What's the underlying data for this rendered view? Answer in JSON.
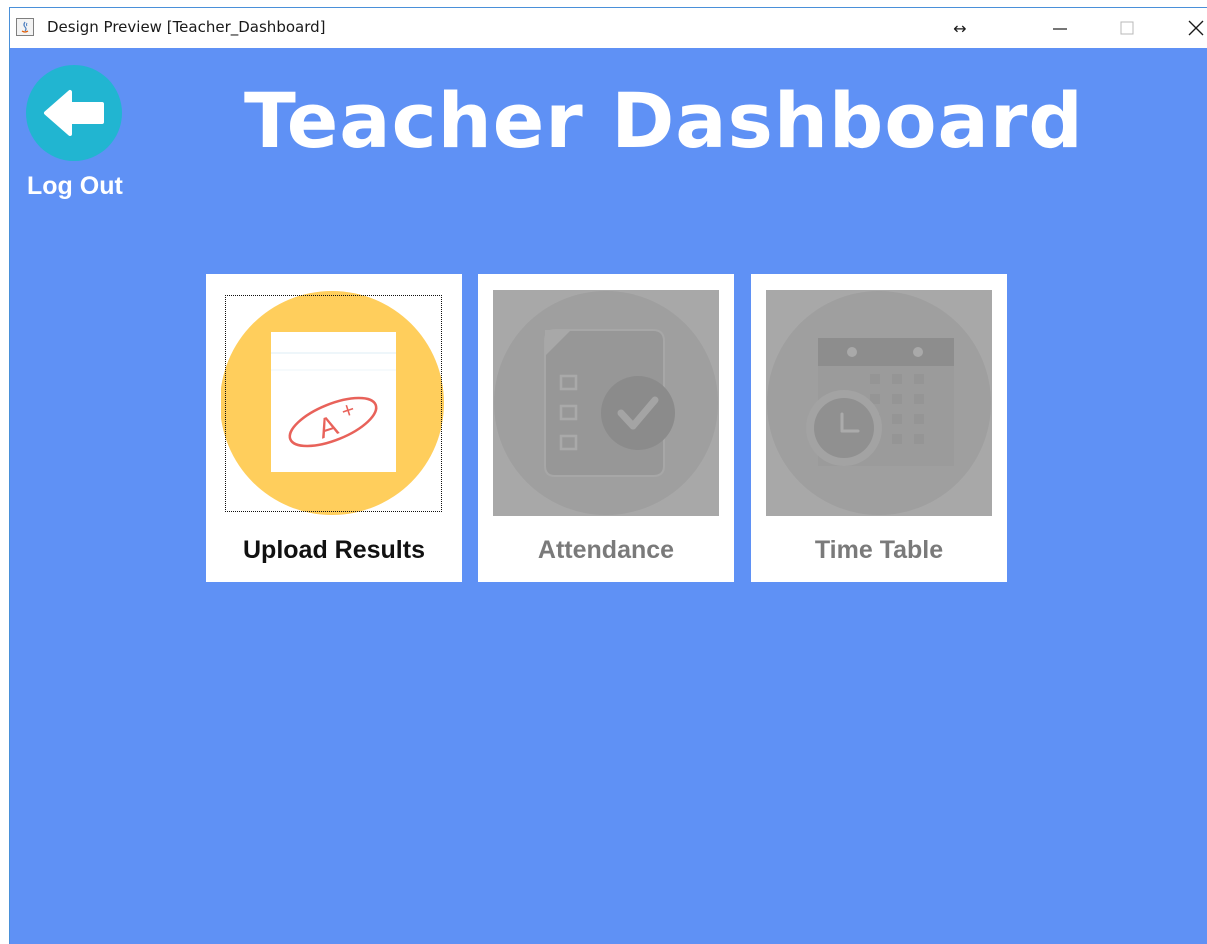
{
  "window": {
    "title": "Design Preview [Teacher_Dashboard]",
    "controls": {
      "resize": "↔",
      "minimize": "minimize-icon",
      "maximize": "maximize-icon",
      "close": "close-icon"
    }
  },
  "header": {
    "title": "Teacher Dashboard",
    "logout_label": "Log Out",
    "back_icon": "arrow-left-icon"
  },
  "cards": [
    {
      "label": "Upload Results",
      "icon": "grade-paper-icon",
      "state": "active"
    },
    {
      "label": "Attendance",
      "icon": "clipboard-check-icon",
      "state": "disabled"
    },
    {
      "label": "Time Table",
      "icon": "calendar-clock-icon",
      "state": "disabled"
    }
  ],
  "colors": {
    "background": "#5f91f5",
    "logout_button": "#21b5d1",
    "upload_circle": "#ffce5c",
    "disabled_bg": "#a8a8a8",
    "disabled_circle": "#9f9f9f",
    "disabled_icon": "#979797"
  }
}
